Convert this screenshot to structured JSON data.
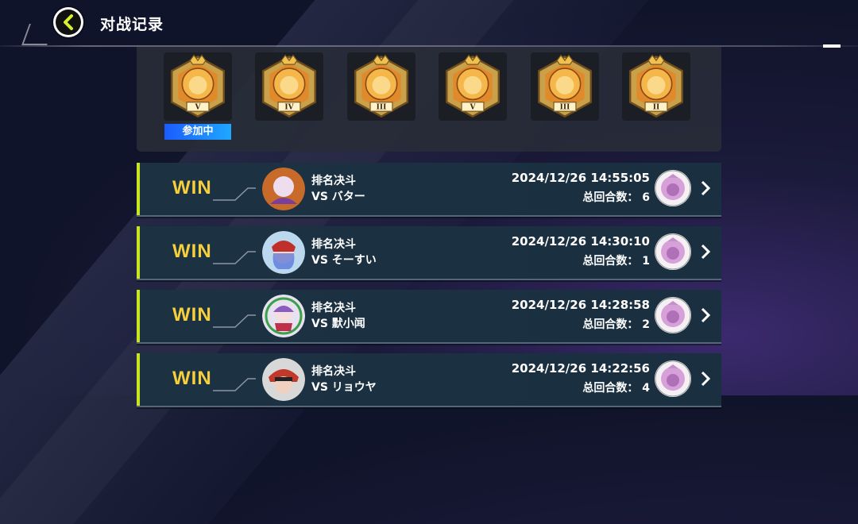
{
  "header": {
    "title": "对战记录"
  },
  "rank_panel": {
    "badges": [
      {
        "tier": "V",
        "active": true
      },
      {
        "tier": "IV",
        "active": false
      },
      {
        "tier": "III",
        "active": false
      },
      {
        "tier": "V",
        "active": false
      },
      {
        "tier": "III",
        "active": false
      },
      {
        "tier": "II",
        "active": false
      }
    ],
    "participating_label": "参加中"
  },
  "matches": [
    {
      "result": "WIN",
      "mode": "排名决斗",
      "opponent": "VS バター",
      "datetime": "2024/12/26 14:55:05",
      "turns_label": "总回合数：",
      "turns": "6",
      "avatar_color": "#c86a2a"
    },
    {
      "result": "WIN",
      "mode": "排名决斗",
      "opponent": "VS そーすい",
      "datetime": "2024/12/26 14:30:10",
      "turns_label": "总回合数：",
      "turns": "1",
      "avatar_color": "#4a6fd0"
    },
    {
      "result": "WIN",
      "mode": "排名决斗",
      "opponent": "VS 默小闻",
      "datetime": "2024/12/26 14:28:58",
      "turns_label": "总回合数：",
      "turns": "2",
      "avatar_color": "#b27ad8"
    },
    {
      "result": "WIN",
      "mode": "排名决斗",
      "opponent": "VS リョウヤ",
      "datetime": "2024/12/26 14:22:56",
      "turns_label": "总回合数：",
      "turns": "4",
      "avatar_color": "#c0392b"
    }
  ],
  "colors": {
    "win": "#f5cf3c",
    "accent": "#c8e620",
    "participating": "#1b7cff"
  }
}
